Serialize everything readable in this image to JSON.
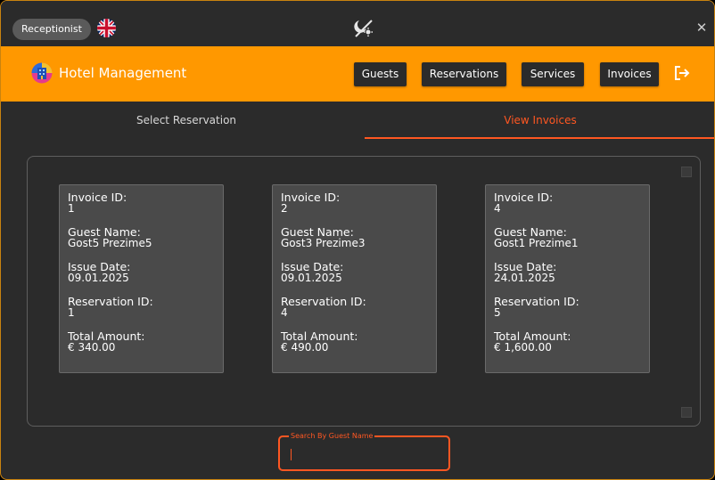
{
  "titlebar": {
    "role": "Receptionist",
    "language_icon": "uk-flag-icon",
    "theme_icon": "theme-toggle-icon",
    "close_label": "✕"
  },
  "header": {
    "app_title": "Hotel Management",
    "nav": {
      "guests": "Guests",
      "reservations": "Reservations",
      "services": "Services",
      "invoices": "Invoices"
    },
    "logout_icon": "logout-icon"
  },
  "tabs": {
    "select_reservation": "Select Reservation",
    "view_invoices": "View Invoices",
    "active": "view_invoices"
  },
  "labels": {
    "invoice_id": "Invoice ID:",
    "guest_name": "Guest Name:",
    "issue_date": "Issue Date:",
    "reservation_id": "Reservation ID:",
    "total_amount": "Total Amount:"
  },
  "invoices": [
    {
      "invoice_id": "1",
      "guest_name": "Gost5 Prezime5",
      "issue_date": "09.01.2025",
      "reservation_id": "1",
      "total_amount": "€ 340.00"
    },
    {
      "invoice_id": "2",
      "guest_name": "Gost3 Prezime3",
      "issue_date": "09.01.2025",
      "reservation_id": "4",
      "total_amount": "€ 490.00"
    },
    {
      "invoice_id": "4",
      "guest_name": "Gost1 Prezime1",
      "issue_date": "24.01.2025",
      "reservation_id": "5",
      "total_amount": "€ 1,600.00"
    }
  ],
  "search": {
    "label": "Search By Guest Name",
    "value": ""
  },
  "colors": {
    "accent_orange": "#ff9800",
    "accent_red": "#ff5722",
    "background": "#2b2b2b",
    "card": "#4a4a4a"
  }
}
